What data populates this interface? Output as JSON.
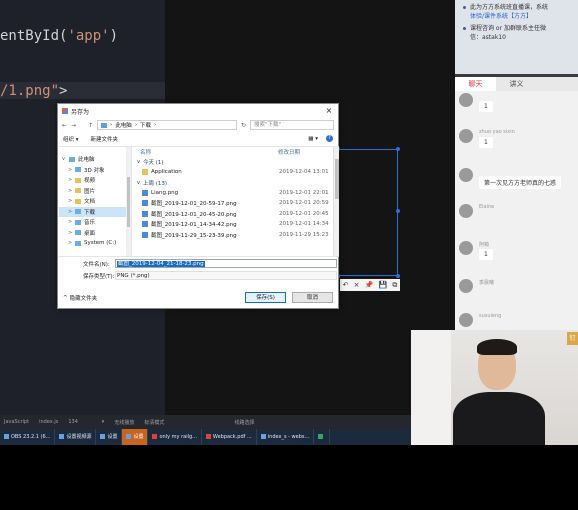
{
  "editor": {
    "line1_code": "entById(",
    "line1_string": "'app'",
    "line1_close": ")",
    "line2_string": "/1.png\"",
    "line2_close": ">"
  },
  "chat": {
    "notice": {
      "line1": "此为方方系统班直播课，系统",
      "link1": "体验/课件系统【方方】",
      "line2": "课程咨询 or 加群联系主任微",
      "line3": "信：astak10"
    },
    "tabs": [
      "聊天",
      "讲义",
      ""
    ],
    "messages": [
      {
        "name": "",
        "text": "1"
      },
      {
        "name": "zhuo yao sixin",
        "text": "1"
      },
      {
        "name": "",
        "text": "第一次见方方老师真的七惑"
      },
      {
        "name": "Elaine",
        "text": ""
      },
      {
        "name": "",
        "text": "1"
      },
      {
        "name": "阿萌",
        "text": ""
      },
      {
        "name": "季晨曦",
        "text": ""
      },
      {
        "name": "susuieng",
        "text": ""
      }
    ]
  },
  "webcam": {
    "badge": "钉"
  },
  "dialog": {
    "title": "另存为",
    "close_glyph": "×",
    "nav_back": "←",
    "nav_forward": "→",
    "nav_up": "↑",
    "breadcrumb": [
      "此电脑",
      "下载"
    ],
    "refresh_glyph": "↻",
    "search_placeholder": "搜索\"下载\"",
    "organize_label": "组织 ▾",
    "new_folder_label": "新建文件夹",
    "help_glyph": "?",
    "nav_items": [
      {
        "label": "此电脑",
        "level": 0,
        "icon": "pc"
      },
      {
        "label": "3D 对象",
        "level": 1,
        "icon": "folder"
      },
      {
        "label": "视频",
        "level": 1,
        "icon": "folder"
      },
      {
        "label": "图片",
        "level": 1,
        "icon": "folder"
      },
      {
        "label": "文档",
        "level": 1,
        "icon": "folder"
      },
      {
        "label": "下载",
        "level": 1,
        "icon": "download",
        "selected": true
      },
      {
        "label": "音乐",
        "level": 1,
        "icon": "music"
      },
      {
        "label": "桌面",
        "level": 1,
        "icon": "desktop"
      },
      {
        "label": "System (C:)",
        "level": 1,
        "icon": "drive"
      }
    ],
    "columns": {
      "name": "名称",
      "date": "修改日期"
    },
    "groups": [
      {
        "label": "今天 (1)",
        "files": [
          {
            "name": "Application",
            "date": "2019-12-04 13:01",
            "type": "folder"
          }
        ]
      },
      {
        "label": "上周 (13)",
        "files": [
          {
            "name": "Liang.png",
            "date": "2019-12-01 22:01",
            "type": "image"
          },
          {
            "name": "截图_2019-12-01_20-59-17.png",
            "date": "2019-12-01 20:59",
            "type": "image"
          },
          {
            "name": "截图_2019-12-01_20-45-20.png",
            "date": "2019-12-01 20:45",
            "type": "image"
          },
          {
            "name": "截图_2019-12-01_14-34-42.png",
            "date": "2019-12-01 14:34",
            "type": "image"
          },
          {
            "name": "截图_2019-11-29_15-23-39.png",
            "date": "2019-11-29 15:23",
            "type": "image"
          }
        ]
      }
    ],
    "filename_label": "文件名(N):",
    "filename_value": "截图_2019-12-04_21-18-23.png",
    "filetype_label": "保存类型(T):",
    "filetype_value": "PNG (*.png)",
    "hide_folders_label": "隐藏文件夹",
    "save_label": "保存(S)",
    "cancel_label": "取消"
  },
  "capture_toolbar": [
    "↶",
    "×",
    "📌",
    "💾",
    "⧉"
  ],
  "taskbar": {
    "status_items": [
      "JavaScript",
      "index.js",
      "134"
    ],
    "player_items": [
      "⏵",
      "无线播放",
      "标清模式",
      "",
      "线路选择"
    ],
    "apps": [
      {
        "label": "OBS 23.2.1 (6...",
        "icon": "blue",
        "highlight": false
      },
      {
        "label": "设置视频源",
        "icon": "blue",
        "highlight": false
      },
      {
        "label": "设置",
        "icon": "blue",
        "highlight": false
      },
      {
        "label": "设置",
        "icon": "blue",
        "highlight": true
      },
      {
        "label": "only my railg...",
        "icon": "red",
        "highlight": false
      },
      {
        "label": "Webpack.pdf ...",
        "icon": "red",
        "highlight": false
      },
      {
        "label": "index_s - webs...",
        "icon": "blue",
        "highlight": false
      },
      {
        "label": "",
        "icon": "green",
        "highlight": false
      }
    ]
  },
  "colors": {
    "editor_bg": "#1e2129",
    "string": "#ce9178",
    "selection_blue": "#1b6ac9",
    "chat_active_tab": "#e23a3a",
    "taskbar_highlight": "#c9641f"
  }
}
